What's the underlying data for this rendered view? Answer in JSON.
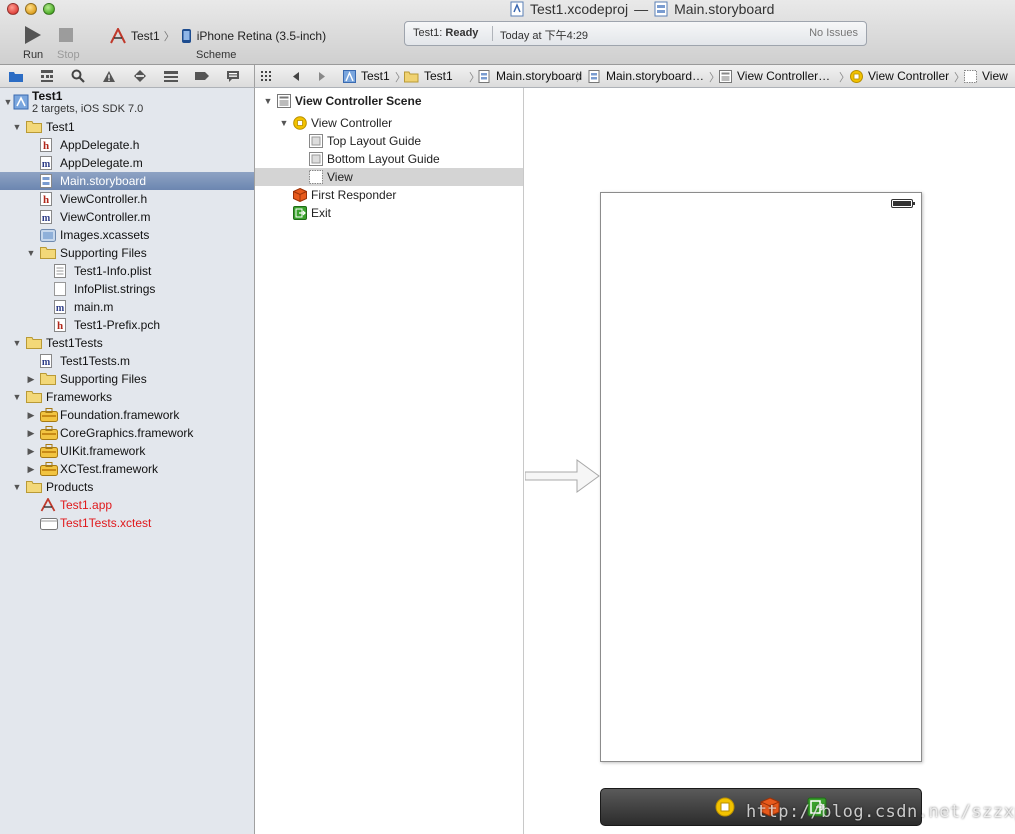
{
  "window": {
    "title_project": "Test1.xcodeproj",
    "title_separator": "—",
    "title_file": "Main.storyboard"
  },
  "toolbar": {
    "run_label": "Run",
    "stop_label": "Stop",
    "scheme_label": "Scheme",
    "scheme_target": "Test1",
    "scheme_separator": "〉",
    "scheme_destination": "iPhone Retina (3.5-inch)"
  },
  "activity": {
    "status_prefix": "Test1: ",
    "status_value": "Ready",
    "time": "Today at 下午4:29",
    "issues": "No Issues"
  },
  "navigator": {
    "project": {
      "name": "Test1",
      "subtitle": "2 targets, iOS SDK 7.0"
    },
    "rows": [
      {
        "label": "Test1",
        "icon": "folder-icon",
        "disclosure": "▼"
      },
      {
        "label": "AppDelegate.h",
        "icon": "header-file-icon",
        "glyph": "h"
      },
      {
        "label": "AppDelegate.m",
        "icon": "objc-file-icon",
        "glyph": "m"
      },
      {
        "label": "Main.storyboard",
        "icon": "storyboard-file-icon",
        "selected": true
      },
      {
        "label": "ViewController.h",
        "icon": "header-file-icon",
        "glyph": "h"
      },
      {
        "label": "ViewController.m",
        "icon": "objc-file-icon",
        "glyph": "m"
      },
      {
        "label": "Images.xcassets",
        "icon": "asset-catalog-icon"
      },
      {
        "label": "Supporting Files",
        "icon": "folder-icon",
        "disclosure": "▼"
      },
      {
        "label": "Test1-Info.plist",
        "icon": "plist-file-icon"
      },
      {
        "label": "InfoPlist.strings",
        "icon": "strings-file-icon"
      },
      {
        "label": "main.m",
        "icon": "objc-file-icon",
        "glyph": "m"
      },
      {
        "label": "Test1-Prefix.pch",
        "icon": "header-file-icon",
        "glyph": "h"
      },
      {
        "label": "Test1Tests",
        "icon": "folder-icon",
        "disclosure": "▼"
      },
      {
        "label": "Test1Tests.m",
        "icon": "objc-file-icon",
        "glyph": "m"
      },
      {
        "label": "Supporting Files",
        "icon": "folder-icon",
        "disclosure": "▶"
      },
      {
        "label": "Frameworks",
        "icon": "folder-icon",
        "disclosure": "▼"
      },
      {
        "label": "Foundation.framework",
        "icon": "framework-icon",
        "disclosure": "▶"
      },
      {
        "label": "CoreGraphics.framework",
        "icon": "framework-icon",
        "disclosure": "▶"
      },
      {
        "label": "UIKit.framework",
        "icon": "framework-icon",
        "disclosure": "▶"
      },
      {
        "label": "XCTest.framework",
        "icon": "framework-icon",
        "disclosure": "▶"
      },
      {
        "label": "Products",
        "icon": "folder-icon",
        "disclosure": "▼"
      },
      {
        "label": "Test1.app",
        "icon": "app-product-icon",
        "missing": true
      },
      {
        "label": "Test1Tests.xctest",
        "icon": "xctest-product-icon",
        "missing": true
      }
    ]
  },
  "jump_bar": {
    "items": [
      "Test1",
      "Test1",
      "Main.storyboard",
      "Main.storyboard…",
      "View Controller…",
      "View Controller",
      "View"
    ],
    "separator": "〉"
  },
  "outline": {
    "scene_title": "View Controller Scene",
    "items": [
      {
        "label": "View Controller",
        "icon": "view-controller-icon",
        "disclosure": "▼"
      },
      {
        "label": "Top Layout Guide",
        "icon": "layout-guide-icon"
      },
      {
        "label": "Bottom Layout Guide",
        "icon": "layout-guide-icon"
      },
      {
        "label": "View",
        "icon": "view-icon",
        "selected": true
      },
      {
        "label": "First Responder",
        "icon": "first-responder-icon"
      },
      {
        "label": "Exit",
        "icon": "exit-icon"
      }
    ]
  },
  "canvas": {
    "watermark": "http://blog.csdn.net/szzxp"
  },
  "colors": {
    "selection_blue": "#7189b3",
    "missing_product_red": "#e0191c",
    "sidebar_bg": "#e3e7ed",
    "view_controller_yellow": "#f2c200",
    "first_responder_orange": "#e85a1c",
    "exit_green": "#3aa12c"
  }
}
